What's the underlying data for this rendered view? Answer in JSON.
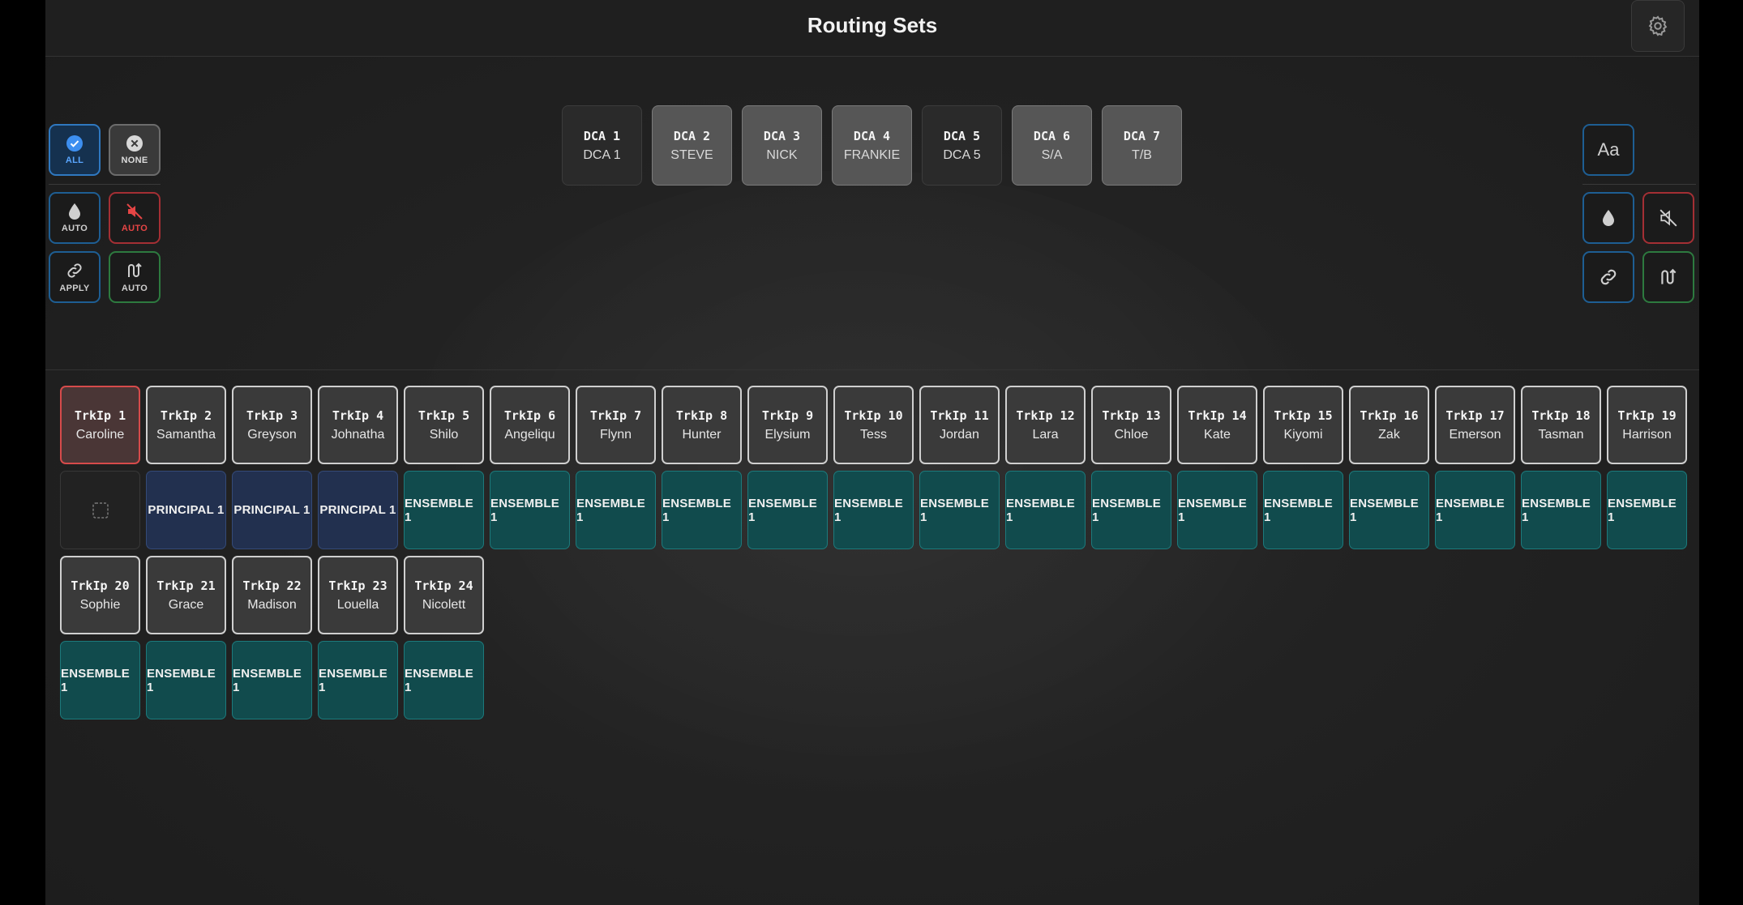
{
  "header": {
    "title": "Routing Sets",
    "settings_icon": "gear-icon"
  },
  "left_tools": {
    "all_label": "ALL",
    "none_label": "NONE",
    "auto_drop_label": "AUTO",
    "auto_mute_label": "AUTO",
    "apply_label": "APPLY",
    "auto_route_label": "AUTO"
  },
  "right_tools": {
    "font_label": "Aa"
  },
  "dcas": [
    {
      "num": "DCA 1",
      "name": "DCA 1",
      "lit": false
    },
    {
      "num": "DCA 2",
      "name": "STEVE",
      "lit": true
    },
    {
      "num": "DCA 3",
      "name": "NICK",
      "lit": true
    },
    {
      "num": "DCA 4",
      "name": "FRANKIE",
      "lit": true
    },
    {
      "num": "DCA 5",
      "name": "DCA 5",
      "lit": false
    },
    {
      "num": "DCA 6",
      "name": "S/A",
      "lit": true
    },
    {
      "num": "DCA 7",
      "name": "T/B",
      "lit": true
    }
  ],
  "tracks": [
    {
      "num": "TrkIp 1",
      "name": "Caroline",
      "set": "",
      "type": "empty",
      "selected": true
    },
    {
      "num": "TrkIp 2",
      "name": "Samantha",
      "set": "PRINCIPAL 1",
      "type": "principal"
    },
    {
      "num": "TrkIp 3",
      "name": "Greyson",
      "set": "PRINCIPAL 1",
      "type": "principal"
    },
    {
      "num": "TrkIp 4",
      "name": "Johnatha",
      "set": "PRINCIPAL 1",
      "type": "principal"
    },
    {
      "num": "TrkIp 5",
      "name": "Shilo",
      "set": "ENSEMBLE 1",
      "type": "ensemble"
    },
    {
      "num": "TrkIp 6",
      "name": "Angeliqu",
      "set": "ENSEMBLE 1",
      "type": "ensemble"
    },
    {
      "num": "TrkIp 7",
      "name": "Flynn",
      "set": "ENSEMBLE 1",
      "type": "ensemble"
    },
    {
      "num": "TrkIp 8",
      "name": "Hunter",
      "set": "ENSEMBLE 1",
      "type": "ensemble"
    },
    {
      "num": "TrkIp 9",
      "name": "Elysium",
      "set": "ENSEMBLE 1",
      "type": "ensemble"
    },
    {
      "num": "TrkIp 10",
      "name": "Tess",
      "set": "ENSEMBLE 1",
      "type": "ensemble"
    },
    {
      "num": "TrkIp 11",
      "name": "Jordan",
      "set": "ENSEMBLE 1",
      "type": "ensemble"
    },
    {
      "num": "TrkIp 12",
      "name": "Lara",
      "set": "ENSEMBLE 1",
      "type": "ensemble"
    },
    {
      "num": "TrkIp 13",
      "name": "Chloe",
      "set": "ENSEMBLE 1",
      "type": "ensemble"
    },
    {
      "num": "TrkIp 14",
      "name": "Kate",
      "set": "ENSEMBLE 1",
      "type": "ensemble"
    },
    {
      "num": "TrkIp 15",
      "name": "Kiyomi",
      "set": "ENSEMBLE 1",
      "type": "ensemble"
    },
    {
      "num": "TrkIp 16",
      "name": "Zak",
      "set": "ENSEMBLE 1",
      "type": "ensemble"
    },
    {
      "num": "TrkIp 17",
      "name": "Emerson",
      "set": "ENSEMBLE 1",
      "type": "ensemble"
    },
    {
      "num": "TrkIp 18",
      "name": "Tasman",
      "set": "ENSEMBLE 1",
      "type": "ensemble"
    },
    {
      "num": "TrkIp 19",
      "name": "Harrison",
      "set": "ENSEMBLE 1",
      "type": "ensemble"
    },
    {
      "num": "TrkIp 20",
      "name": "Sophie",
      "set": "ENSEMBLE 1",
      "type": "ensemble"
    },
    {
      "num": "TrkIp 21",
      "name": "Grace",
      "set": "ENSEMBLE 1",
      "type": "ensemble"
    },
    {
      "num": "TrkIp 22",
      "name": "Madison",
      "set": "ENSEMBLE 1",
      "type": "ensemble"
    },
    {
      "num": "TrkIp 23",
      "name": "Louella",
      "set": "ENSEMBLE 1",
      "type": "ensemble"
    },
    {
      "num": "TrkIp 24",
      "name": "Nicolett",
      "set": "ENSEMBLE 1",
      "type": "ensemble"
    }
  ]
}
